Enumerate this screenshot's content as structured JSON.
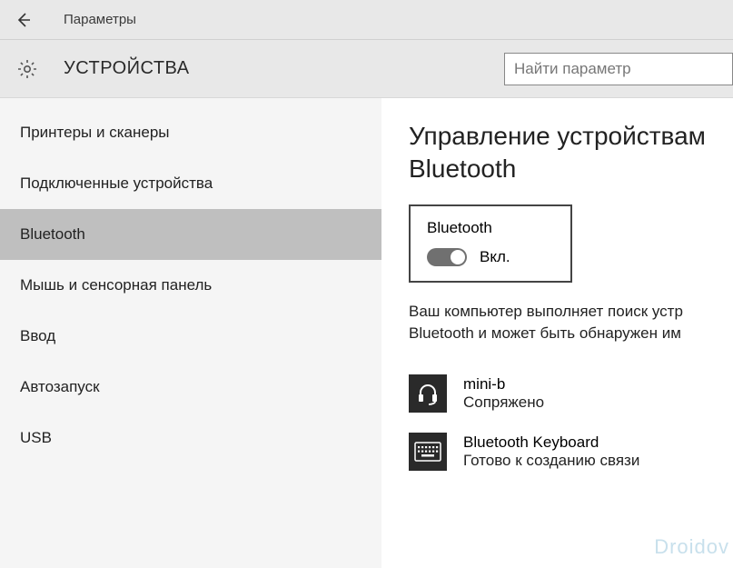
{
  "titlebar": {
    "title": "Параметры"
  },
  "header": {
    "heading": "УСТРОЙСТВА"
  },
  "search": {
    "placeholder": "Найти параметр"
  },
  "sidebar": {
    "items": [
      {
        "label": "Принтеры и сканеры",
        "active": false
      },
      {
        "label": "Подключенные устройства",
        "active": false
      },
      {
        "label": "Bluetooth",
        "active": true
      },
      {
        "label": "Мышь и сенсорная панель",
        "active": false
      },
      {
        "label": "Ввод",
        "active": false
      },
      {
        "label": "Автозапуск",
        "active": false
      },
      {
        "label": "USB",
        "active": false
      }
    ]
  },
  "content": {
    "heading": "Управление устройствам\nBluetooth",
    "toggle": {
      "label": "Bluetooth",
      "state": "Вкл.",
      "on": true
    },
    "status_line1": "Ваш компьютер выполняет поиск устр",
    "status_line2": "Bluetooth и может быть обнаружен им",
    "devices": [
      {
        "name": "mini-b",
        "status": "Сопряжено",
        "icon": "headset"
      },
      {
        "name": "Bluetooth Keyboard",
        "status": "Готово к созданию связи",
        "icon": "keyboard"
      }
    ]
  },
  "watermark": "Droidov"
}
